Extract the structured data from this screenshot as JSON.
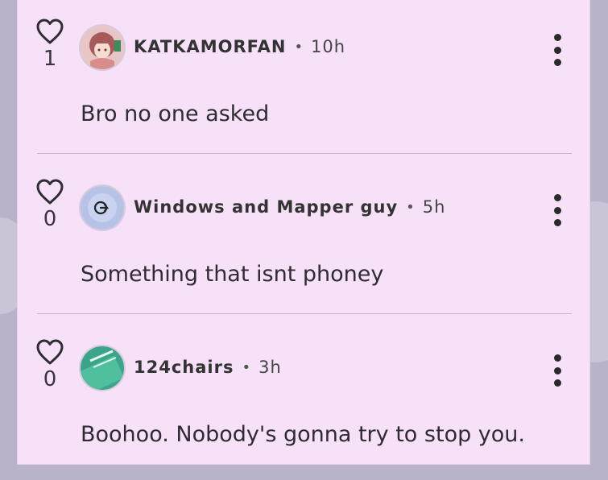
{
  "comments": [
    {
      "likes": "1",
      "username": "KATKAMORFAN",
      "time": "10h",
      "text": "Bro no one asked",
      "avatar": "anime-girl-avatar"
    },
    {
      "likes": "0",
      "username": "Windows and Mapper guy",
      "time": "5h",
      "text": "Something that isnt phoney",
      "avatar": "logo-avatar"
    },
    {
      "likes": "0",
      "username": "124chairs",
      "time": "3h",
      "text": "Boohoo. Nobody's gonna try to stop you.",
      "avatar": "green-124-avatar"
    }
  ],
  "separator": "•",
  "colors": {
    "panel": "#f6e1f8",
    "background": "#b8b3c9",
    "text": "#2e2b33"
  }
}
